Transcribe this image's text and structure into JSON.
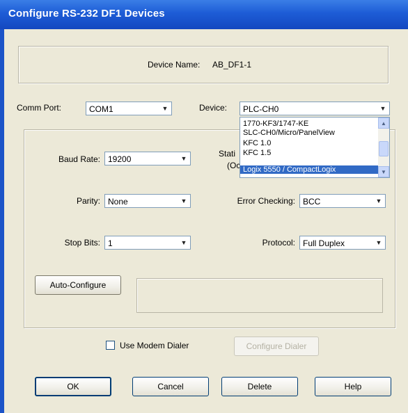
{
  "window": {
    "title": "Configure RS-232 DF1 Devices"
  },
  "device_name": {
    "label": "Device Name:",
    "value": "AB_DF1-1"
  },
  "comm_port": {
    "label": "Comm Port:",
    "value": "COM1"
  },
  "device": {
    "label": "Device:",
    "value": "PLC-CH0",
    "options": [
      "1770-KF3/1747-KE",
      "SLC-CH0/Micro/PanelView",
      "KFC 1.0",
      "KFC 1.5",
      "Logix 5550 / CompactLogix"
    ],
    "selected_option": "Logix 5550 / CompactLogix"
  },
  "baud_rate": {
    "label": "Baud Rate:",
    "value": "19200"
  },
  "station": {
    "label_line1": "Stati",
    "label_line2": "(Oc"
  },
  "parity": {
    "label": "Parity:",
    "value": "None"
  },
  "error_checking": {
    "label": "Error Checking:",
    "value": "BCC"
  },
  "stop_bits": {
    "label": "Stop Bits:",
    "value": "1"
  },
  "protocol": {
    "label": "Protocol:",
    "value": "Full Duplex"
  },
  "auto_configure_label": "Auto-Configure",
  "modem": {
    "checkbox_label": "Use Modem Dialer",
    "checked": false,
    "configure_label": "Configure Dialer"
  },
  "buttons": {
    "ok": "OK",
    "cancel": "Cancel",
    "delete": "Delete",
    "help": "Help"
  },
  "icons": {
    "dropdown_arrow": "chevron-down-icon",
    "scroll_up": "chevron-up-icon",
    "scroll_down": "chevron-down-icon"
  },
  "colors": {
    "title_bar": "#1d5cd6",
    "selection": "#316ac5",
    "face": "#ece9d8"
  }
}
